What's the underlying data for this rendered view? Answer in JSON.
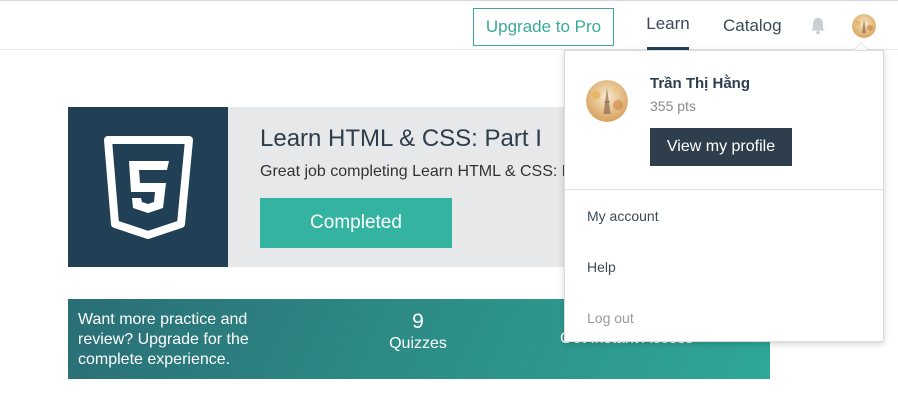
{
  "topbar": {
    "upgrade_label": "Upgrade to Pro",
    "nav": {
      "learn": "Learn",
      "catalog": "Catalog"
    },
    "icons": {
      "bell": "bell-icon",
      "avatar": "avatar"
    }
  },
  "course": {
    "title": "Learn HTML & CSS: Part I",
    "description": "Great job completing Learn HTML & CSS: Pa",
    "button_label": "Completed",
    "logo_icon": "html5-icon"
  },
  "promo": {
    "text": "Want more practice and review? Upgrade for the complete experience.",
    "stat_value": "9",
    "stat_label": "Quizzes",
    "cta": "Get Instant Access »"
  },
  "dropdown": {
    "user_name": "Trần Thị Hằng",
    "points": "355 pts",
    "profile_button": "View my profile",
    "items": [
      {
        "label": "My account"
      },
      {
        "label": "Help"
      },
      {
        "label": "Log out"
      }
    ]
  },
  "colors": {
    "accent": "#3aa99a",
    "completed": "#34b3a0",
    "navy": "#213f55",
    "profile_btn": "#2f3e4c"
  }
}
